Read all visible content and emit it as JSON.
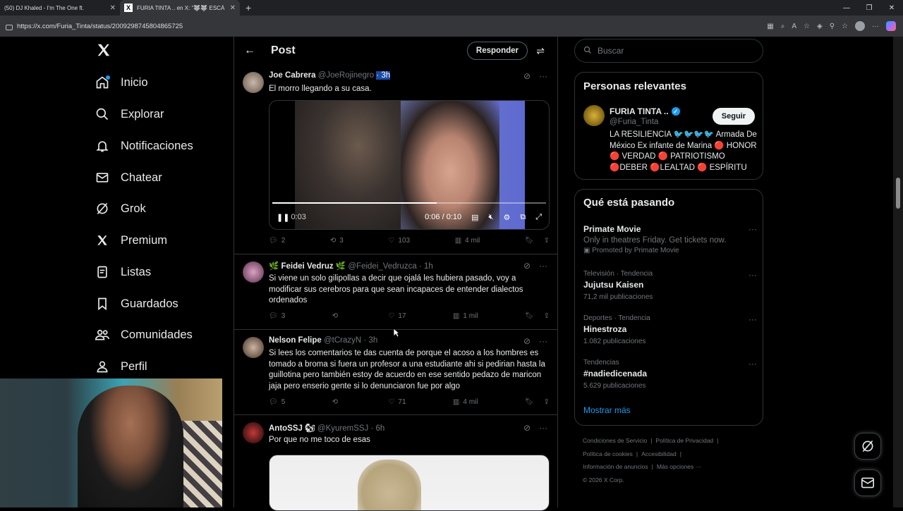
{
  "browser": {
    "tabs": [
      {
        "title": "(50) DJ Khaled - I'm The One ft.",
        "active": false
      },
      {
        "title": "FURIA TINTA .. en X: \"🐺🐺 ESCÁ",
        "active": true
      }
    ],
    "url": "https://x.com/Furia_Tinta/status/2009298745804865725"
  },
  "nav": {
    "items": [
      {
        "label": "Inicio",
        "icon": "home-icon"
      },
      {
        "label": "Explorar",
        "icon": "search-icon"
      },
      {
        "label": "Notificaciones",
        "icon": "bell-icon"
      },
      {
        "label": "Chatear",
        "icon": "mail-icon"
      },
      {
        "label": "Grok",
        "icon": "grok-icon"
      },
      {
        "label": "Premium",
        "icon": "x-logo-icon"
      },
      {
        "label": "Listas",
        "icon": "list-icon"
      },
      {
        "label": "Guardados",
        "icon": "bookmark-icon"
      },
      {
        "label": "Comunidades",
        "icon": "communities-icon"
      },
      {
        "label": "Perfil",
        "icon": "profile-icon"
      }
    ]
  },
  "header": {
    "title": "Post",
    "reply_label": "Responder"
  },
  "tweets": [
    {
      "name": "Joe Cabrera",
      "handle": "@JoeRojinegro",
      "time": "· 3h",
      "text": "El morro llegando a su casa.",
      "video": {
        "current_time": "0:06",
        "duration": "0:10",
        "left_time": "0:03",
        "progress": 0.6
      },
      "replies": "2",
      "reposts": "3",
      "likes": "103",
      "views": "4 mil"
    },
    {
      "name": "🌿 Feidei Vedruz 🌿",
      "handle": "@Feidei_Vedruzca",
      "time": "· 1h",
      "text": "Si viene un solo gilipollas a decir que ojalá les hubiera pasado, voy a modificar sus cerebros para que sean incapaces de entender dialectos ordenados",
      "replies": "3",
      "reposts": "",
      "likes": "17",
      "views": "1 mil"
    },
    {
      "name": "Nelson Felipe",
      "handle": "@tCrazyN",
      "time": "· 3h",
      "text": "Si lees los comentarios te das cuenta de porque el acoso a los hombres es tomado a broma si fuera un profesor a una estudiante ahi si pedirian hasta la guillotina pero también estoy de acuerdo en ese sentido pedazo de maricon jaja pero enserio gente si lo denunciaron fue por algo",
      "replies": "5",
      "reposts": "",
      "likes": "71",
      "views": "4 mil"
    },
    {
      "name": "AntoSSJ 🐿",
      "handle": "@KyuremSSJ",
      "time": "· 6h",
      "text": "Por que no me toco de esas"
    }
  ],
  "sidebar": {
    "search_placeholder": "Buscar",
    "relevant": {
      "title": "Personas relevantes",
      "name": "FURIA TINTA ..",
      "handle": "@Furia_Tinta",
      "follow_label": "Seguir",
      "bio": "LA RESILIENCIA 🐦🐦🐦🐦 Armada De México Ex infante de Marina 🔴 HONOR 🔴 VERDAD 🔴 PATRIOTISMO 🔴DEBER 🔴LEALTAD 🔴 ESPÍRITU"
    },
    "trending": {
      "title": "Qué está pasando",
      "items": [
        {
          "context": "",
          "title": "Primate Movie",
          "subtitle": "Only in theatres Friday. Get tickets now.",
          "count": "Promoted by Primate Movie"
        },
        {
          "context": "Televisión · Tendencia",
          "title": "Jujutsu Kaisen",
          "subtitle": "",
          "count": "71,2 mil publicaciones"
        },
        {
          "context": "Deportes · Tendencia",
          "title": "Hinestroza",
          "subtitle": "",
          "count": "1.082 publicaciones"
        },
        {
          "context": "Tendencias",
          "title": "#nadiedicenada",
          "subtitle": "",
          "count": "5.629 publicaciones"
        }
      ],
      "show_more": "Mostrar más"
    },
    "footer": {
      "links": [
        "Condiciones de Servicio",
        "Política de Privacidad",
        "Política de cookies",
        "Accesibilidad",
        "Información de anuncios",
        "Más opciones ···"
      ],
      "copyright": "© 2026 X Corp."
    }
  },
  "colors": {
    "accent": "#1d9bf0",
    "background": "#000000",
    "border": "#2f3336",
    "muted": "#71767b"
  }
}
